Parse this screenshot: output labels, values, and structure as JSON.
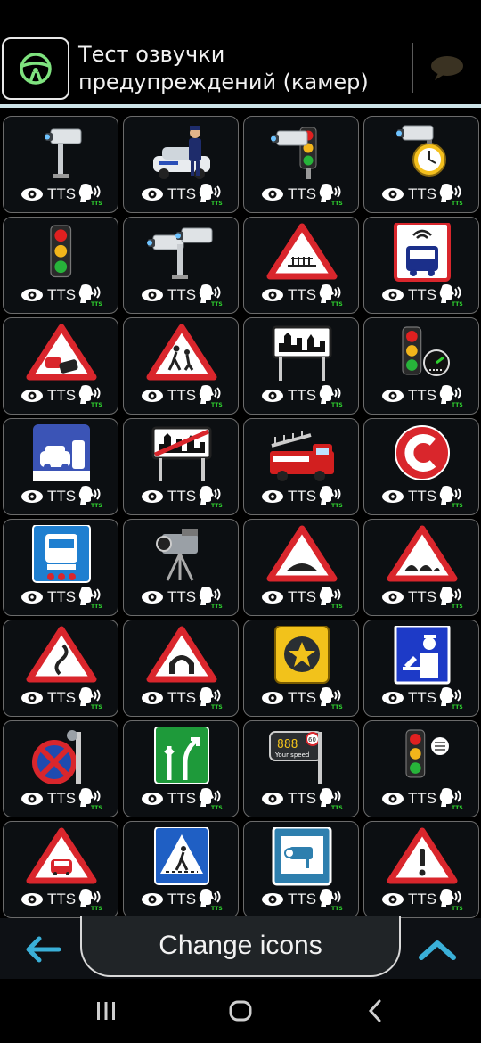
{
  "header": {
    "title": "Тест озвучки предупреждений (камер)",
    "home_icon": "steering-wheel-icon",
    "chat_icon": "speech-bubble-icon"
  },
  "tiles": [
    {
      "name": "tile-speed-camera",
      "icon": "speed-camera-icon",
      "tts": "TTS"
    },
    {
      "name": "tile-police-patrol",
      "icon": "police-car-icon",
      "tts": "TTS"
    },
    {
      "name": "tile-traffic-light-camera",
      "icon": "traffic-light-camera-icon",
      "tts": "TTS"
    },
    {
      "name": "tile-average-speed-camera",
      "icon": "camera-stopwatch-icon",
      "tts": "TTS"
    },
    {
      "name": "tile-traffic-light",
      "icon": "traffic-light-icon",
      "tts": "TTS"
    },
    {
      "name": "tile-double-camera",
      "icon": "double-camera-icon",
      "tts": "TTS"
    },
    {
      "name": "tile-railway-crossing",
      "icon": "railway-crossing-icon",
      "tts": "TTS"
    },
    {
      "name": "tile-bus-lane-camera",
      "icon": "bus-lane-icon",
      "tts": "TTS"
    },
    {
      "name": "tile-accident-warning",
      "icon": "accident-warning-icon",
      "tts": "TTS"
    },
    {
      "name": "tile-children-warning",
      "icon": "children-warning-icon",
      "tts": "TTS"
    },
    {
      "name": "tile-city-entry",
      "icon": "city-entry-sign-icon",
      "tts": "TTS"
    },
    {
      "name": "tile-traffic-light-speedometer",
      "icon": "traffic-light-speedometer-icon",
      "tts": "TTS"
    },
    {
      "name": "tile-toll-booth",
      "icon": "toll-booth-icon",
      "tts": "TTS"
    },
    {
      "name": "tile-city-exit",
      "icon": "city-exit-sign-icon",
      "tts": "TTS"
    },
    {
      "name": "tile-fire-truck",
      "icon": "fire-truck-icon",
      "tts": "TTS"
    },
    {
      "name": "tile-congestion-charge",
      "icon": "congestion-charge-icon",
      "tts": "TTS"
    },
    {
      "name": "tile-truck-sign",
      "icon": "truck-sign-icon",
      "tts": "TTS"
    },
    {
      "name": "tile-mobile-camera",
      "icon": "tripod-camera-icon",
      "tts": "TTS"
    },
    {
      "name": "tile-speed-bump",
      "icon": "speed-bump-icon",
      "tts": "TTS"
    },
    {
      "name": "tile-uneven-road",
      "icon": "uneven-road-icon",
      "tts": "TTS"
    },
    {
      "name": "tile-dangerous-curves",
      "icon": "dangerous-curves-icon",
      "tts": "TTS"
    },
    {
      "name": "tile-tunnel",
      "icon": "tunnel-warning-icon",
      "tts": "TTS"
    },
    {
      "name": "tile-favorite-point",
      "icon": "star-badge-icon",
      "tts": "TTS"
    },
    {
      "name": "tile-police-control",
      "icon": "police-control-icon",
      "tts": "TTS"
    },
    {
      "name": "tile-no-stopping-camera",
      "icon": "no-stopping-camera-icon",
      "tts": "TTS"
    },
    {
      "name": "tile-highway-exit",
      "icon": "highway-exit-icon",
      "tts": "TTS"
    },
    {
      "name": "tile-your-speed-sign",
      "icon": "your-speed-sign-icon",
      "tts": "TTS",
      "sign_digits": "888",
      "sign_limit": "60",
      "sign_text": "Your speed"
    },
    {
      "name": "tile-traffic-light-sound",
      "icon": "traffic-light-sound-icon",
      "tts": "TTS"
    },
    {
      "name": "tile-car-warning",
      "icon": "car-warning-icon",
      "tts": "TTS"
    },
    {
      "name": "tile-pedestrian-crossing",
      "icon": "pedestrian-crossing-icon",
      "tts": "TTS"
    },
    {
      "name": "tile-camera-sign",
      "icon": "camera-sign-icon",
      "tts": "TTS"
    },
    {
      "name": "tile-general-warning",
      "icon": "exclamation-warning-icon",
      "tts": "TTS"
    }
  ],
  "bottom": {
    "back_icon": "arrow-left-icon",
    "change_icons_label": "Change icons",
    "up_icon": "chevron-up-icon"
  },
  "nav": {
    "recent_icon": "recent-apps-icon",
    "home_icon": "nav-home-icon",
    "back_icon": "nav-back-icon"
  },
  "colors": {
    "accent_cyan": "#3ab0d8",
    "tts_green": "#2fd12f",
    "warning_red": "#d9262c"
  }
}
